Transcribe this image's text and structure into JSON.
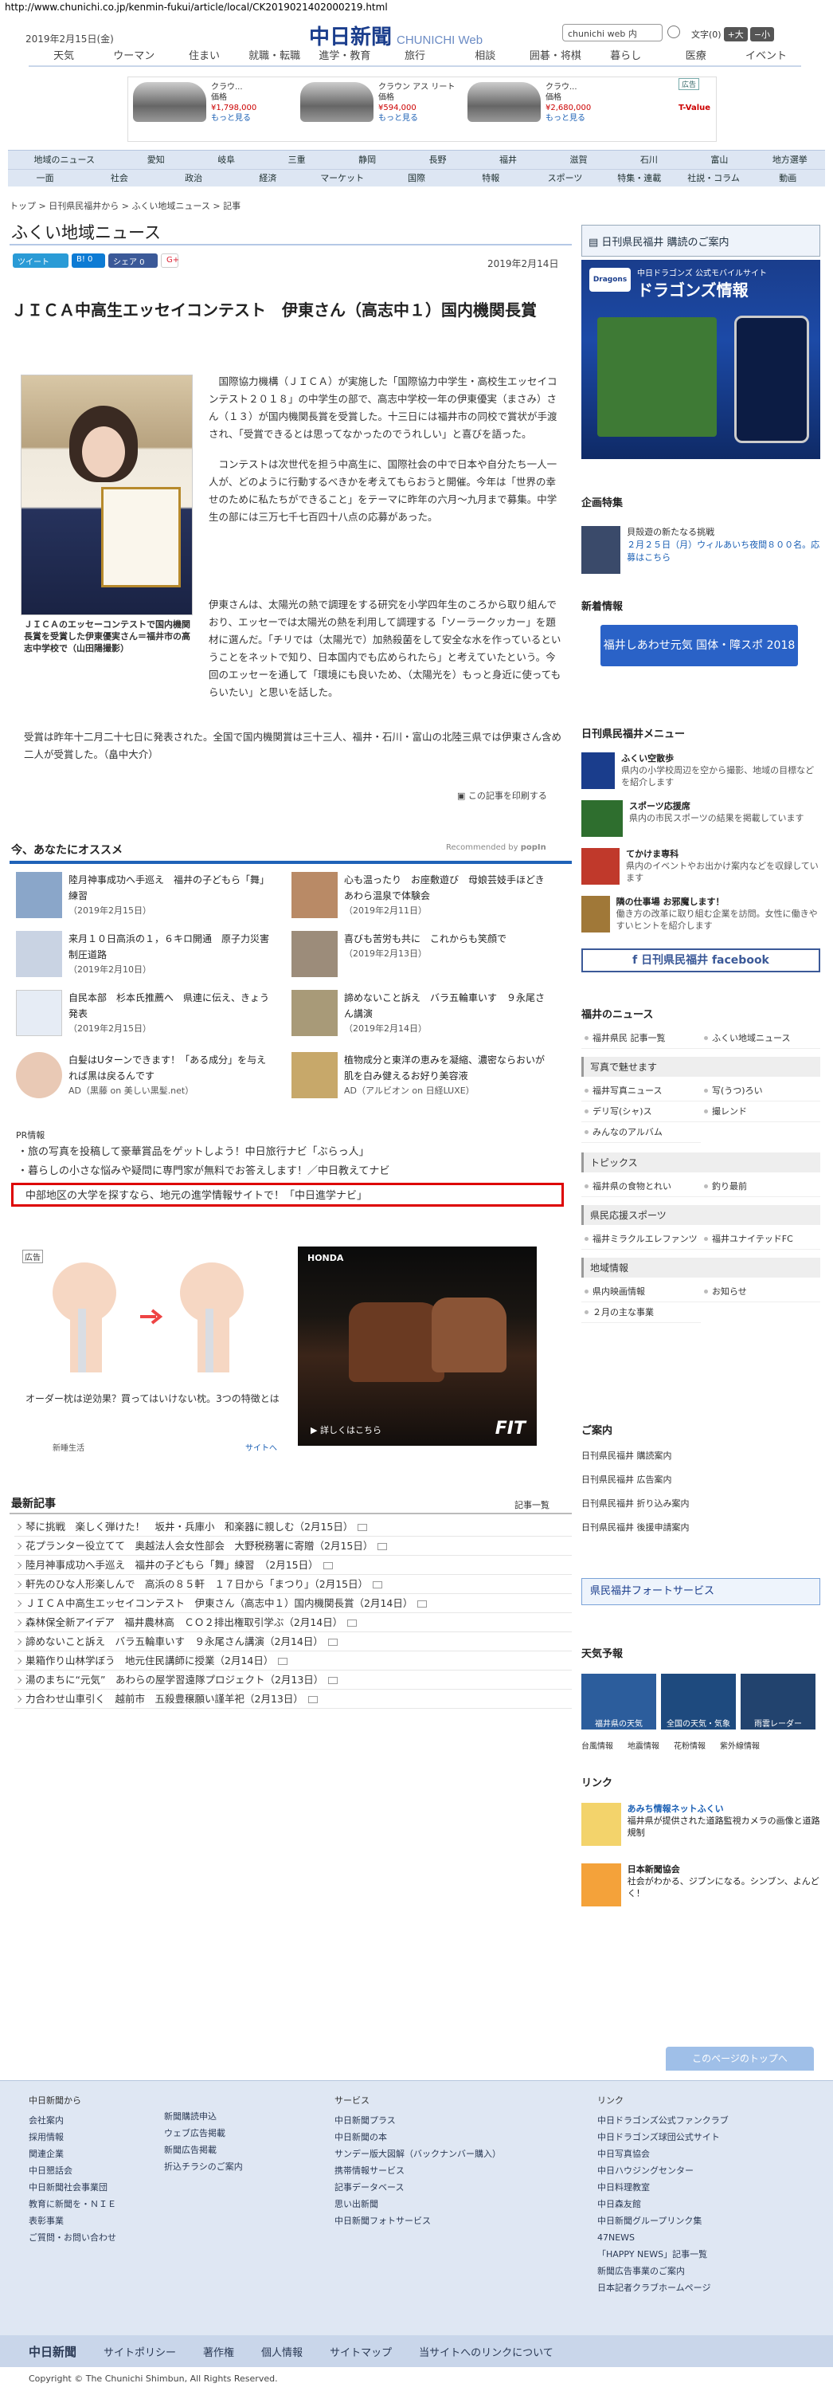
{
  "url": "http://www.chunichi.co.jp/kenmin-fukui/article/local/CK2019021402000219.html",
  "header": {
    "date": "2019年2月15日(金)",
    "logo": "中日新聞",
    "logo_sub": "CHUNICHI Web",
    "search_placeholder": "chunichi web 内",
    "font_label": "文字(0)",
    "font_big": "+大",
    "font_small": "−小"
  },
  "topnav": [
    "天気",
    "ウーマン",
    "住まい",
    "就職・転職",
    "進学・教育",
    "旅行",
    "相談",
    "囲碁・将棋",
    "暮らし",
    "医療",
    "イベント"
  ],
  "ads": [
    {
      "name": "クラウ...",
      "price_label": "価格",
      "price": "¥1,798,000",
      "more": "もっと見る"
    },
    {
      "name": "クラウン アス リート",
      "price_label": "価格",
      "price": "¥594,000",
      "more": "もっと見る"
    },
    {
      "name": "クラウ...",
      "price_label": "価格",
      "price": "¥2,680,000",
      "more": "もっと見る"
    }
  ],
  "ad_badge": "広告",
  "ad_brand": "T-Value",
  "regions1": [
    "地域のニュース",
    "愛知",
    "岐阜",
    "三重",
    "静岡",
    "長野",
    "福井",
    "滋賀",
    "石川",
    "富山",
    "地方選挙"
  ],
  "regions2": [
    "一面",
    "社会",
    "政治",
    "経済",
    "マーケット",
    "国際",
    "特報",
    "スポーツ",
    "特集・連載",
    "社説・コラム",
    "動画"
  ],
  "breadcrumb": "トップ > 日刊県民福井から > ふくい地域ニュース > 記事",
  "page_title": "ふくい地域ニュース",
  "social": {
    "tweet": "ツイート",
    "hatena": "B! 0",
    "share": "シェア 0",
    "gplus": "G+"
  },
  "article_date": "2019年2月14日",
  "headline": "ＪＩＣＡ中高生エッセイコンテスト　伊東さん（高志中１）国内機関長賞",
  "caption": "ＪＩＣＡのエッセーコンテストで国内機関長賞を受賞した伊東優実さん＝福井市の高志中学校で（山田陽撮影）",
  "para1": "国際協力機構（ＪＩＣＡ）が実施した「国際協力中学生・高校生エッセイコンテスト２０１８」の中学生の部で、高志中学校一年の伊東優実（まさみ）さん（１３）が国内機関長賞を受賞した。十三日には福井市の同校で賞状が手渡され、「受賞できるとは思ってなかったのでうれしい」と喜びを語った。",
  "para2": "コンテストは次世代を担う中高生に、国際社会の中で日本や自分たち一人一人が、どのように行動するべきかを考えてもらおうと開催。今年は「世界の幸せのために私たちができること」をテーマに昨年の六月〜九月まで募集。中学生の部には三万七千七百四十八点の応募があった。",
  "para3a": "伊東さんは、太陽光の熱で調理をする研究を小学四年生のころから取り組んでおり、エッセーでは太陽光の熱を利用して調理する「ソーラークッカー」を題材に選んだ。「チリでは（太陽光で）加熱殺菌をして安全な水を作っているということをネットで知り、日本国内でも広められたら」と考えていたという。今回のエッセーを通して「環境にも良いため、（太陽光を）もっと身近に使ってもらいたい」と思いを話した。",
  "para4": "受賞は昨年十二月二十七日に発表された。全国で国内機関賞は三十三人、福井・石川・富山の北陸三県では伊東さん含め二人が受賞した。（畠中大介）",
  "print": "この記事を印刷する",
  "reco": {
    "title": "今、あなたにオススメ",
    "by": "Recommended by",
    "brand": "popIn",
    "items": [
      {
        "t": "陸月神事成功へ手巡え　福井の子どもら「舞」練習",
        "d": "（2019年2月15日）"
      },
      {
        "t": "心も温ったり　お座敷遊び　母娘芸妓手ほどき　あわら温泉で体験会",
        "d": "（2019年2月11日）"
      },
      {
        "t": "来月１０日高浜の１，６キロ開通　原子力災害制圧道路",
        "d": "（2019年2月10日）"
      },
      {
        "t": "喜びも苦労も共に　これからも笑顔で",
        "d": "（2019年2月13日）"
      },
      {
        "t": "自民本部　杉本氏推薦へ　県連に伝え、きょう発表",
        "d": "（2019年2月15日）"
      },
      {
        "t": "諦めないこと訴え　バラ五輪車いす　９永尾さん講演",
        "d": "（2019年2月14日）"
      },
      {
        "t": "白髪はUターンできます！「ある成分」を与えれば黒は戻るんです",
        "d": "AD（黒藤 on 美しい黒髪.net）"
      },
      {
        "t": "植物成分と東洋の恵みを凝縮、濃密ならおいが肌を白み健えるお好り美容液",
        "d": "AD（アルビオン on 日経LUXE）"
      }
    ]
  },
  "pr": {
    "label": "PR情報",
    "links": [
      "旅の写真を投稿して豪華賞品をゲットしよう！中日旅行ナビ「ぶらっ人」",
      "暮らしの小さな悩みや疑問に専門家が無料でお答えします！／中日教えてナビ"
    ],
    "highlight": "中部地区の大学を探すなら、地元の進学情報サイトで！「中日進学ナビ」"
  },
  "ad_left": {
    "tag": "広告",
    "text": "オーダー枕は逆効果？買ってはいけない枕。3つの特徴とは",
    "source": "新睡生活",
    "link": "サイトへ"
  },
  "ad_right": {
    "brand": "HONDA",
    "more": "▶ 詳しくはこちら",
    "car": "FIT"
  },
  "latest": {
    "title": "最新記事",
    "all": "記事一覧",
    "items": [
      "琴に挑戦　楽しく弾けた！　坂井・兵庫小　和楽器に親しむ（2月15日）",
      "花プランター役立てて　奥越法人会女性部会　大野税務署に寄贈（2月15日）",
      "陸月神事成功へ手巡え　福井の子どもら「舞」練習　（2月15日）",
      "軒先のひな人形楽しんで　高浜の８５軒　１７日から「まつり」（2月15日）",
      "ＪＩＣＡ中高生エッセイコンテスト　伊東さん（高志中１）国内機関長賞（2月14日）",
      "森林保全新アイデア　福井農林高　ＣＯ２排出権取引学ぶ（2月14日）",
      "諦めないこと訴え　バラ五輪車いす　９永尾さん講演（2月14日）",
      "巣箱作り山林学ぼう　地元住民講師に授業（2月14日）",
      "湯のまちに“元気”　あわらの屋学習遠隊プロジェクト（2月13日）",
      "力合わせ山車引く　越前市　五殺豊穣願い謹羊祀（2月13日）"
    ]
  },
  "right": {
    "subscribe": "日刊県民福井 購読のご案内",
    "dragons": {
      "label": "中日ドラゴンズ 公式モバイルサイト",
      "title": "ドラゴンズ情報"
    },
    "kikaku": {
      "title": "企画特集",
      "item": "貝殻遊の新たなる挑戦",
      "date": "２月２５日（月）ウィルあいち夜間８００名。応募はこちら"
    },
    "shinsai": {
      "title": "新着情報",
      "banner": "福井しあわせ元気 国体・障スポ 2018"
    },
    "menu": {
      "title": "日刊県民福井メニュー",
      "items": [
        {
          "t": "ふくい空散歩",
          "d": "県内の小学校周辺を空から撮影、地域の目標などを紹介します"
        },
        {
          "t": "スポーツ応援席",
          "d": "県内の市民スポーツの結果を掲載しています"
        },
        {
          "t": "てかけま専科",
          "d": "県内のイベントやお出かけ案内などを収録しています"
        },
        {
          "t": "隣の仕事場 お邪魔します！",
          "d": "働き方の改革に取り組む企業を訪問。女性に働きやすいヒントを紹介します"
        }
      ]
    },
    "facebook": "日刊県民福井 facebook",
    "news": {
      "title": "福井のニュース",
      "items": [
        "福井県民 記事一覧",
        "ふくい地域ニュース"
      ]
    },
    "photos": {
      "title": "写真で魅せます",
      "items": [
        "福井写真ニュース",
        "写(うつ)ろい",
        "デリ写(シャ)ス",
        "撮レンド",
        "みんなのアルバム"
      ]
    },
    "topics": {
      "title": "トピックス",
      "items": [
        "福井県の食物とれい",
        "釣り最前"
      ]
    },
    "sports": {
      "title": "県民応援スポーツ",
      "items": [
        "福井ミラクルエレファンツ",
        "福井ユナイテッドFC"
      ]
    },
    "local": {
      "title": "地域情報",
      "items": [
        "県内映画情報",
        "お知らせ",
        "２月の主な事業"
      ]
    },
    "guide": {
      "title": "ご案内",
      "items": [
        "日刊県民福井 購読案内",
        "日刊県民福井 広告案内",
        "日刊県民福井 折り込み案内",
        "日刊県民福井 後援申請案内"
      ]
    },
    "forte": "県民福井フォートサービス",
    "weather": {
      "title": "天気予報",
      "items": [
        "福井県の天気",
        "全国の天気・気象",
        "雨雲レーダー"
      ],
      "links": [
        "台風情報",
        "地震情報",
        "花粉情報",
        "紫外線情報"
      ]
    },
    "links": {
      "title": "リンク",
      "items": [
        {
          "t": "あみち情報ネットふくい",
          "d": "福井県が提供された道路監視カメラの画像と道路規制"
        },
        {
          "t": "日本新聞協会",
          "d": "社会がわかる、ジブンになる。シンブン、よんどく！"
        }
      ]
    }
  },
  "totop": "このページのトップへ",
  "footer": {
    "col1_title": "中日新聞から",
    "col1": [
      "会社案内",
      "採用情報",
      "関連企業",
      "中日懇話会",
      "中日新聞社会事業団",
      "教育に新聞を・ＮＩＥ",
      "表彰事業",
      "ご質問・お問い合わせ"
    ],
    "col2": [
      "新聞購読申込",
      "ウェブ広告掲載",
      "新聞広告掲載",
      "折込チラシのご案内"
    ],
    "col3_title": "サービス",
    "col3": [
      "中日新聞プラス",
      "中日新聞の本",
      "サンデー版大図解（バックナンバー購入）",
      "携帯情報サービス",
      "記事データベース",
      "思い出新聞",
      "中日新聞フォトサービス"
    ],
    "col4_title": "リンク",
    "col4": [
      "中日ドラゴンズ公式ファンクラブ",
      "中日ドラゴンズ球団公式サイト",
      "中日写真協会",
      "中日ハウジングセンター",
      "中日料理教室",
      "中日森友館",
      "中日新聞グループリンク集",
      "47NEWS",
      "「HAPPY NEWS」記事一覧",
      "新聞広告事業のご案内",
      "日本記者クラブホームページ"
    ]
  },
  "bottomnav": [
    "中日新聞",
    "サイトポリシー",
    "著作権",
    "個人情報",
    "サイトマップ",
    "当サイトへのリンクについて"
  ],
  "copyright": "Copyright © The Chunichi Shimbun, All Rights Reserved."
}
